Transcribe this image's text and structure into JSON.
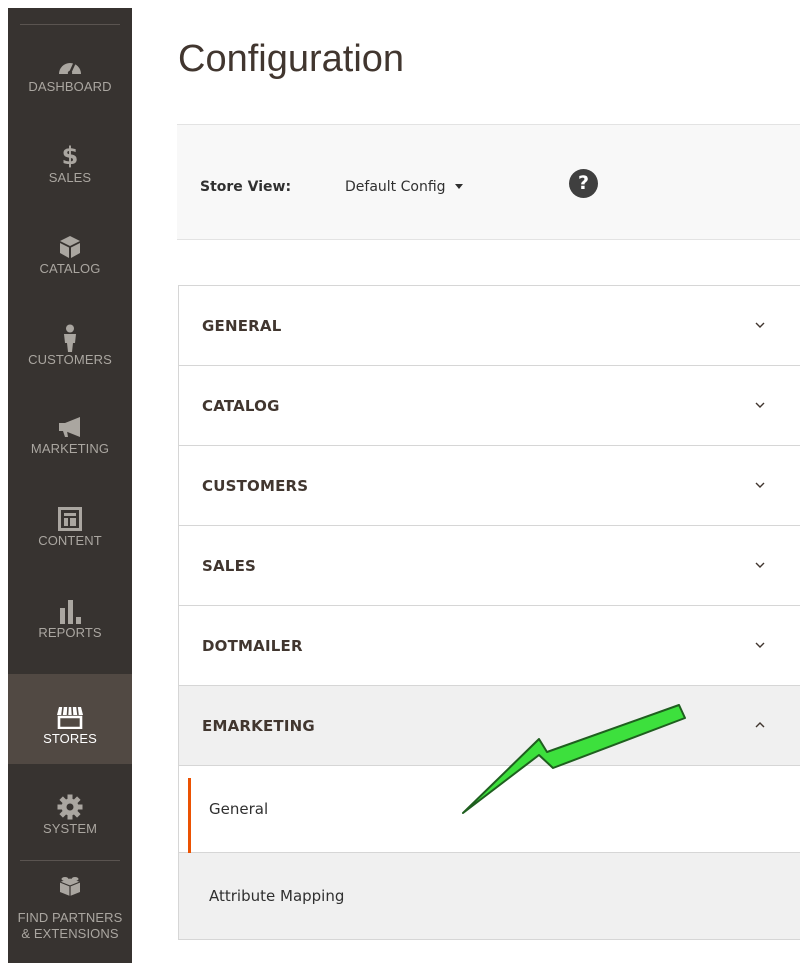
{
  "sidebar": {
    "items": [
      {
        "label": "DASHBOARD",
        "icon": "speedometer-icon"
      },
      {
        "label": "SALES",
        "icon": "dollar-icon"
      },
      {
        "label": "CATALOG",
        "icon": "box-icon"
      },
      {
        "label": "CUSTOMERS",
        "icon": "person-icon"
      },
      {
        "label": "MARKETING",
        "icon": "megaphone-icon"
      },
      {
        "label": "CONTENT",
        "icon": "layout-icon"
      },
      {
        "label": "REPORTS",
        "icon": "bar-chart-icon"
      },
      {
        "label": "STORES",
        "icon": "storefront-icon",
        "active": true
      },
      {
        "label": "SYSTEM",
        "icon": "gear-icon"
      }
    ],
    "partners_line1": "FIND PARTNERS",
    "partners_line2": "& EXTENSIONS",
    "partners_icon": "lego-brick-icon",
    "dollar_glyph": "$"
  },
  "page": {
    "title": "Configuration"
  },
  "store_switcher": {
    "label": "Store View:",
    "value": "Default Config",
    "help_glyph": "?"
  },
  "config_tabs": [
    {
      "title": "GENERAL",
      "expanded": false
    },
    {
      "title": "CATALOG",
      "expanded": false
    },
    {
      "title": "CUSTOMERS",
      "expanded": false
    },
    {
      "title": "SALES",
      "expanded": false
    },
    {
      "title": "DOTMAILER",
      "expanded": false
    },
    {
      "title": "EMARKETING",
      "expanded": true
    }
  ],
  "emarketing_items": [
    {
      "label": "General",
      "active": true
    },
    {
      "label": "Attribute Mapping",
      "active": false
    }
  ],
  "colors": {
    "sidebar_bg": "#373330",
    "sidebar_active": "#514943",
    "accent": "#eb5202",
    "annotation_arrow": "#3de03d"
  }
}
